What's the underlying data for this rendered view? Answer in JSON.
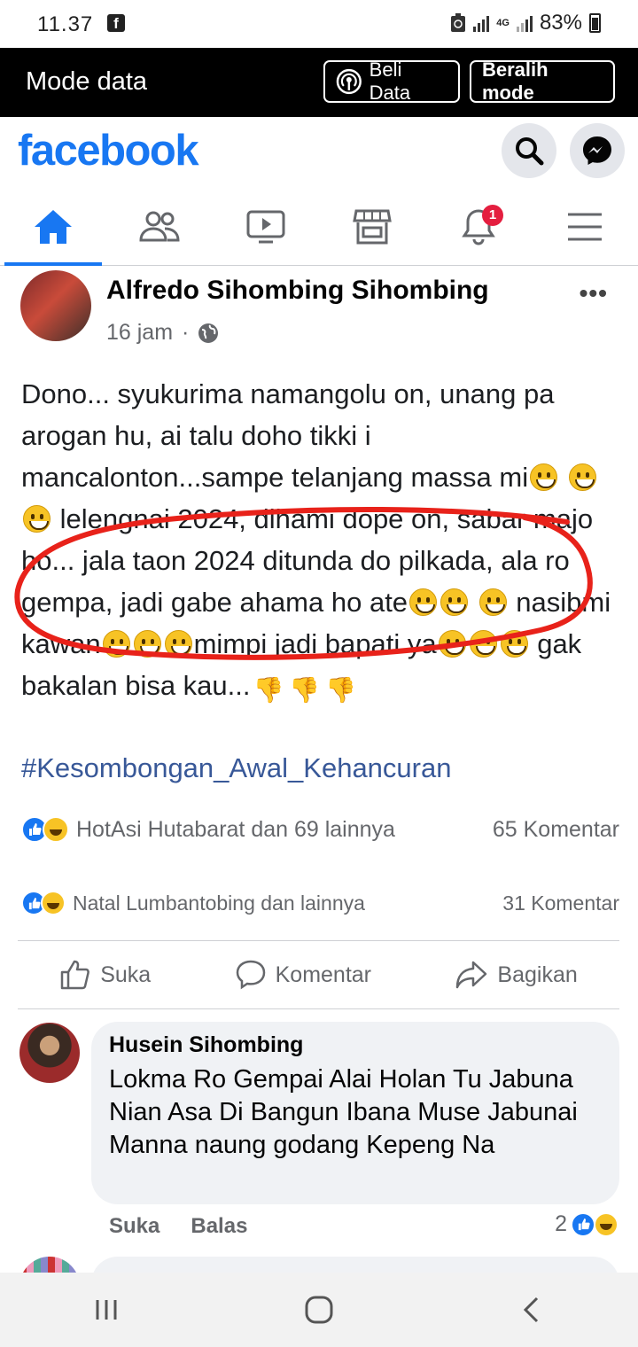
{
  "status_bar": {
    "time": "11.37",
    "app_badge": "f",
    "network": "4G",
    "battery": "83%"
  },
  "data_mode": {
    "label": "Mode data",
    "buy_label": "Beli Data",
    "switch_label": "Beralih mode"
  },
  "header": {
    "logo": "facebook"
  },
  "tabs": [
    {
      "name": "home",
      "icon": "home-icon",
      "active": true
    },
    {
      "name": "friends",
      "icon": "friends-icon"
    },
    {
      "name": "watch",
      "icon": "video-icon"
    },
    {
      "name": "marketplace",
      "icon": "store-icon"
    },
    {
      "name": "notifications",
      "icon": "bell-icon",
      "badge": "1"
    },
    {
      "name": "menu",
      "icon": "hamburger-icon"
    }
  ],
  "post": {
    "author": "Alfredo Sihombing Sihombing",
    "time": "16 jam",
    "separator": "·",
    "text": {
      "p1": "Dono... syukurima namangolu on, unang pa arogan hu, ai talu doho tikki i mancalonton...sampe telanjang massa mi",
      "p2": "lelengnai 2024, dihami dope on, sabar majo ho... jala taon 2024 ditunda do pilkada, ala ro gempa, jadi gabe ahama ho ate",
      "p3": "nasibmi kawan",
      "p4": "mimpi jadi bapati ya",
      "p5": "gak bakalan bisa kau..."
    },
    "hashtag": "#Kesombongan_Awal_Kehancuran",
    "reactions_inner": {
      "names": "HotAsi Hutabarat dan 69 lainnya",
      "comments": "65 Komentar"
    },
    "reactions": {
      "names": "Natal Lumbantobing dan lainnya",
      "comments": "31 Komentar"
    },
    "actions": {
      "like": "Suka",
      "comment": "Komentar",
      "share": "Bagikan"
    }
  },
  "comment": {
    "author": "Husein Sihombing",
    "text": "Lokma Ro Gempai Alai Holan Tu Jabuna Nian Asa Di Bangun Ibana Muse Jabunai Manna naung godang Kepeng Na",
    "like": "Suka",
    "reply": "Balas",
    "reaction_count": "2"
  },
  "colors": {
    "brand": "#1877f2",
    "circle_annotation": "#e8221a"
  }
}
